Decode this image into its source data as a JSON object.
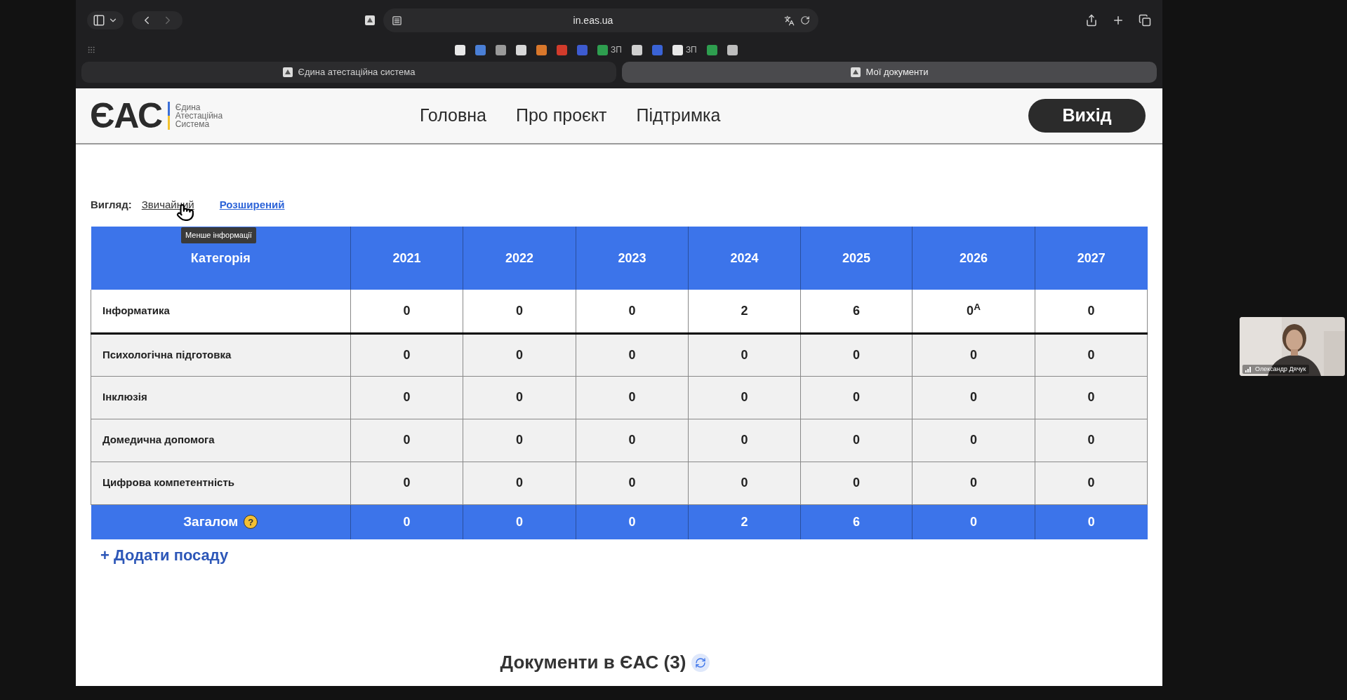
{
  "browser": {
    "url": "in.eas.ua",
    "bookmarks": [
      {
        "color": "#e8e8e8"
      },
      {
        "color": "#4a7fd6"
      },
      {
        "color": "#9a9a9a"
      },
      {
        "color": "#d8d8d8"
      },
      {
        "color": "#d9772b"
      },
      {
        "color": "#d13b2b"
      },
      {
        "color": "#3d5bd0"
      },
      {
        "color": "#2e9e4f",
        "label": "ЗП"
      },
      {
        "color": "#cfcfcf"
      },
      {
        "color": "#3a63d6"
      },
      {
        "color": "#e8e8e8",
        "label": "ЗП"
      },
      {
        "color": "#2e9e4f"
      },
      {
        "color": "#bdbdbd"
      }
    ],
    "tabs": [
      {
        "title": "Єдина атестаційна система",
        "selected": false
      },
      {
        "title": "Мої документи",
        "selected": true
      }
    ]
  },
  "site": {
    "logo": {
      "mark": "ЄАС",
      "lines": [
        "Єдина",
        "Атестаційна",
        "Система"
      ]
    },
    "nav": [
      "Головна",
      "Про проєкт",
      "Підтримка"
    ],
    "logout": "Вихід"
  },
  "view": {
    "label": "Вигляд:",
    "options": [
      {
        "label": "Звичайний",
        "selected": true
      },
      {
        "label": "Розширений",
        "selected": false
      }
    ],
    "tooltip": "Менше інформації"
  },
  "table": {
    "columns": [
      "Категорія",
      "2021",
      "2022",
      "2023",
      "2024",
      "2025",
      "2026",
      "2027"
    ],
    "rows": [
      {
        "highlighted": true,
        "cells": [
          "Інформатика",
          "0",
          "0",
          "0",
          "2",
          "6",
          "0$^{А}$",
          "0"
        ]
      },
      {
        "highlighted": false,
        "cells": [
          "Психологічна підготовка",
          "0",
          "0",
          "0",
          "0",
          "0",
          "0",
          "0"
        ]
      },
      {
        "highlighted": false,
        "cells": [
          "Інклюзія",
          "0",
          "0",
          "0",
          "0",
          "0",
          "0",
          "0"
        ]
      },
      {
        "highlighted": false,
        "cells": [
          "Домедична допомога",
          "0",
          "0",
          "0",
          "0",
          "0",
          "0",
          "0"
        ]
      },
      {
        "highlighted": false,
        "cells": [
          "Цифрова компетентність",
          "0",
          "0",
          "0",
          "0",
          "0",
          "0",
          "0"
        ]
      }
    ],
    "total": {
      "help": "?",
      "cells": [
        "Загалом",
        "0",
        "0",
        "0",
        "2",
        "6",
        "0",
        "0"
      ]
    }
  },
  "add_position": "+ Додати посаду",
  "documents_heading": "Документи в ЄАС (3)",
  "video_tile": {
    "kind": "picture",
    "name": "Олександр Дячук"
  }
}
